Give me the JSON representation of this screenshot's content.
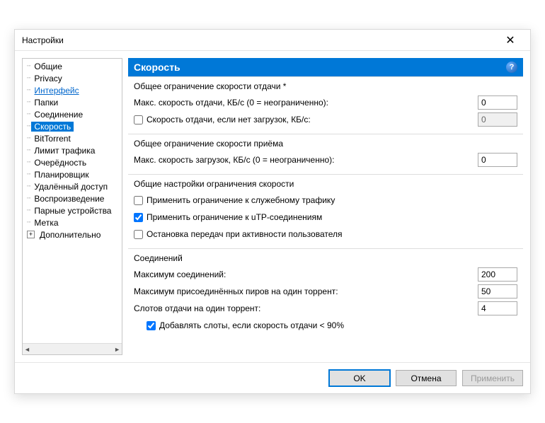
{
  "window": {
    "title": "Настройки",
    "close": "✕"
  },
  "tree": {
    "items": [
      {
        "label": "Общие"
      },
      {
        "label": "Privacy"
      },
      {
        "label": "Интерфейс",
        "link": true
      },
      {
        "label": "Папки"
      },
      {
        "label": "Соединение"
      },
      {
        "label": "Скорость",
        "selected": true
      },
      {
        "label": "BitTorrent"
      },
      {
        "label": "Лимит трафика"
      },
      {
        "label": "Очерёдность"
      },
      {
        "label": "Планировщик"
      },
      {
        "label": "Удалённый доступ"
      },
      {
        "label": "Воспроизведение"
      },
      {
        "label": "Парные устройства"
      },
      {
        "label": "Метка"
      },
      {
        "label": "Дополнительно",
        "expandable": true
      }
    ]
  },
  "panel": {
    "title": "Скорость"
  },
  "upload": {
    "section_title": "Общее ограничение скорости отдачи *",
    "max_label": "Макс. скорость отдачи, КБ/с (0 = неограниченно):",
    "max_value": "0",
    "alt_checked": false,
    "alt_label": "Скорость отдачи, если нет загрузок, КБ/с:",
    "alt_value": "0"
  },
  "download": {
    "section_title": "Общее ограничение скорости приёма",
    "max_label": "Макс. скорость загрузок, КБ/с (0 = неограниченно):",
    "max_value": "0"
  },
  "common": {
    "section_title": "Общие настройки ограничения скорости",
    "overhead_checked": false,
    "overhead_label": "Применить ограничение к служебному трафику",
    "utp_checked": true,
    "utp_label": "Применить ограничение к uTP-соединениям",
    "stop_checked": false,
    "stop_label": "Остановка передач при активности пользователя"
  },
  "conn": {
    "section_title": "Соединений",
    "max_global_label": "Максимум соединений:",
    "max_global_value": "200",
    "max_peers_label": "Максимум присоединённых пиров на один торрент:",
    "max_peers_value": "50",
    "slots_label": "Слотов отдачи на один торрент:",
    "slots_value": "4",
    "extra_checked": true,
    "extra_label": "Добавлять слоты, если скорость отдачи < 90%"
  },
  "buttons": {
    "ok": "OK",
    "cancel": "Отмена",
    "apply": "Применить"
  }
}
